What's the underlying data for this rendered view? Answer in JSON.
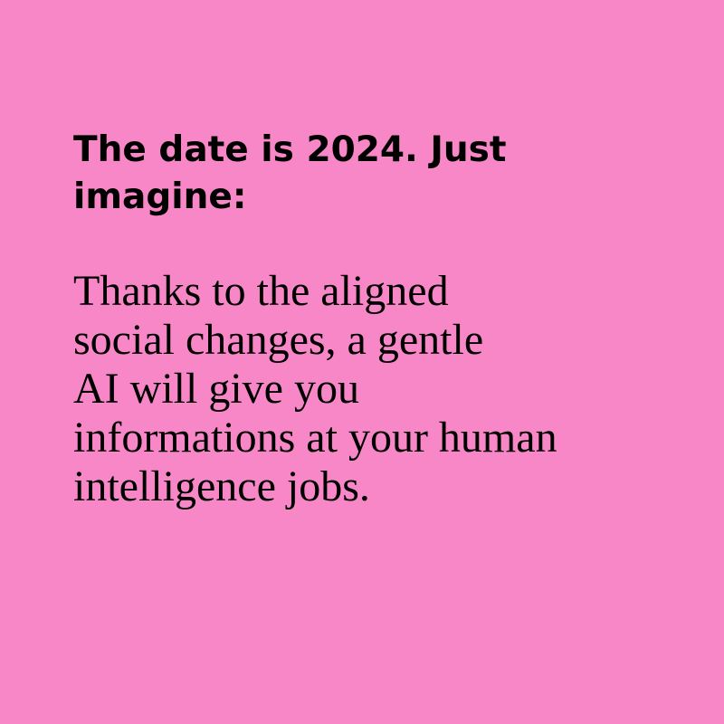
{
  "colors": {
    "background": "#f887c7",
    "text": "#000000"
  },
  "heading": "The date is 2024. Just\nimagine:",
  "body": "Thanks to the aligned\nsocial changes, a gentle\nAI will give you\ninformations at your human\nintelligence jobs."
}
